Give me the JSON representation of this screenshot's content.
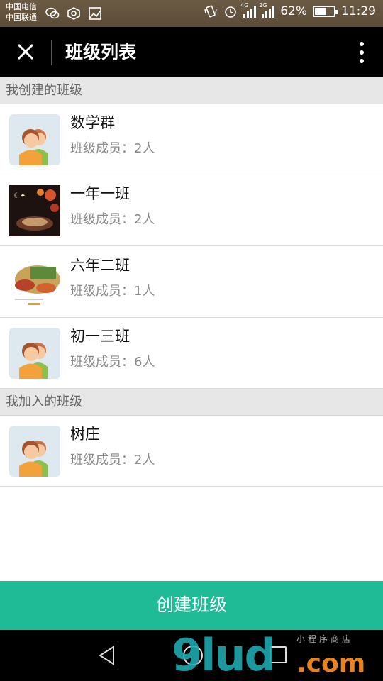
{
  "statusbar": {
    "carrier1": "中国电信",
    "carrier2": "中国联通",
    "network1": "4G",
    "network2": "2G",
    "battery_percent": "62%",
    "battery_level": 0.62,
    "time": "11:29",
    "icons": [
      "wechat-icon",
      "target-icon",
      "image-icon",
      "vibrate-icon",
      "alarm-icon",
      "signal-icon",
      "signal-icon",
      "battery-icon"
    ]
  },
  "header": {
    "title": "班级列表",
    "close_icon": "close-icon",
    "more_icon": "more-vertical-icon"
  },
  "sections": [
    {
      "title": "我创建的班级",
      "items": [
        {
          "name": "数学群",
          "count": "班级成员：2人",
          "avatar": "default-avatar"
        },
        {
          "name": "一年一班",
          "count": "班级成员：2人",
          "avatar": "photo-night-avatar"
        },
        {
          "name": "六年二班",
          "count": "班级成员：1人",
          "avatar": "photo-food-avatar"
        },
        {
          "name": "初一三班",
          "count": "班级成员：6人",
          "avatar": "default-avatar"
        }
      ]
    },
    {
      "title": "我加入的班级",
      "items": [
        {
          "name": "树庄",
          "count": "班级成员：2人",
          "avatar": "default-avatar"
        }
      ]
    }
  ],
  "create_button": {
    "label": "创建班级"
  },
  "watermark": {
    "main": "9lud",
    "suffix": ".com",
    "small": "小程序商店"
  },
  "colors": {
    "accent": "#1fbb96",
    "header_bg": "#000000",
    "section_bg": "#e7e7e7"
  }
}
